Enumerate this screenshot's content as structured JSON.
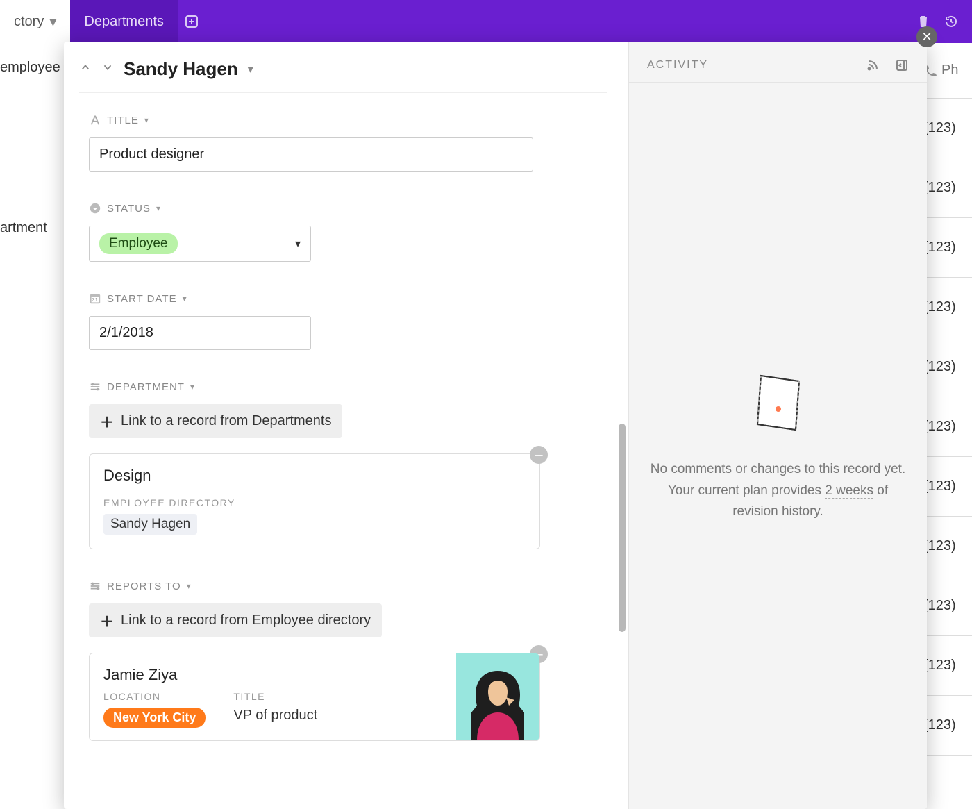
{
  "topbar": {
    "tab1": "ctory",
    "tab2": "Departments"
  },
  "behind": {
    "col1_rows": [
      "employee",
      "",
      "artment"
    ],
    "phone_header": "Ph",
    "phones": [
      "(123)",
      "(123)",
      "(123)",
      "(123)",
      "(123)",
      "(123)",
      "(123)",
      "(123)",
      "(123)",
      "(123)",
      "(123)"
    ]
  },
  "record": {
    "name": "Sandy Hagen",
    "fields": {
      "title": {
        "label": "TITLE",
        "value": "Product designer"
      },
      "status": {
        "label": "STATUS",
        "value": "Employee"
      },
      "start_date": {
        "label": "START DATE",
        "value": "2/1/2018"
      },
      "department": {
        "label": "DEPARTMENT",
        "link_text": "Link to a record from Departments",
        "card": {
          "title": "Design",
          "sub_label": "EMPLOYEE DIRECTORY",
          "tag": "Sandy Hagen"
        }
      },
      "reports_to": {
        "label": "REPORTS TO",
        "link_text": "Link to a record from Employee directory",
        "card": {
          "title": "Jamie Ziya",
          "location_label": "LOCATION",
          "location_value": "New York City",
          "title_label": "TITLE",
          "title_value": "VP of product"
        }
      }
    }
  },
  "activity": {
    "header": "ACTIVITY",
    "empty_1": "No comments or changes to this record yet. Your current plan provides",
    "empty_2": "2 weeks",
    "empty_3": "of revision history."
  }
}
